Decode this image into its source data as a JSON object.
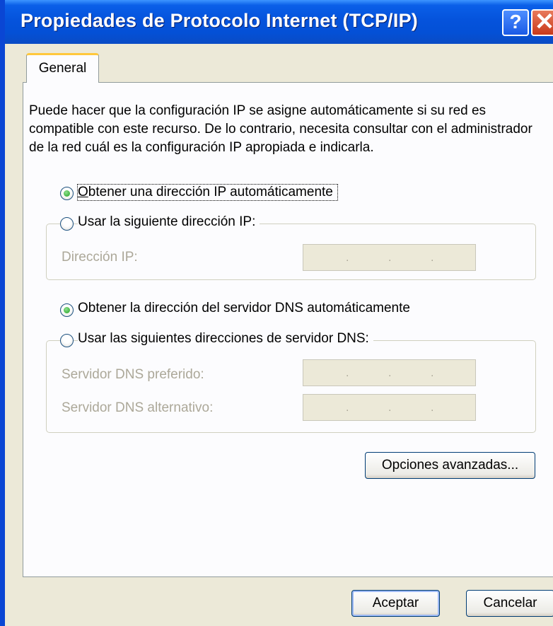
{
  "window": {
    "title": "Propiedades de Protocolo Internet (TCP/IP)",
    "help_label": "?",
    "close_label": "✕"
  },
  "tabs": [
    {
      "label": "General",
      "selected": true
    }
  ],
  "description": "Puede hacer que la configuración IP se asigne automáticamente si su red es compatible con este recurso. De lo contrario, necesita consultar con el administrador de la red cuál es la configuración IP apropiada e indicarla.",
  "ip": {
    "auto_label": "Obtener una dirección IP automáticamente",
    "manual_label": "Usar la siguiente dirección IP:",
    "selected": "auto",
    "address_label": "Dirección IP:",
    "address_value": ". . ."
  },
  "dns": {
    "auto_label": "Obtener la dirección del servidor DNS automáticamente",
    "manual_label": "Usar las siguientes direcciones de servidor DNS:",
    "selected": "auto",
    "preferred_label": "Servidor DNS preferido:",
    "alternate_label": "Servidor DNS alternativo:"
  },
  "buttons": {
    "advanced": "Opciones avanzadas...",
    "ok": "Aceptar",
    "cancel": "Cancelar"
  },
  "colors": {
    "titlebar": "#0553dc",
    "dialog_bg": "#ece9d8",
    "panel_bg": "#fcfcfe",
    "disabled_text": "#aca899",
    "radio_check": "#21a121"
  }
}
